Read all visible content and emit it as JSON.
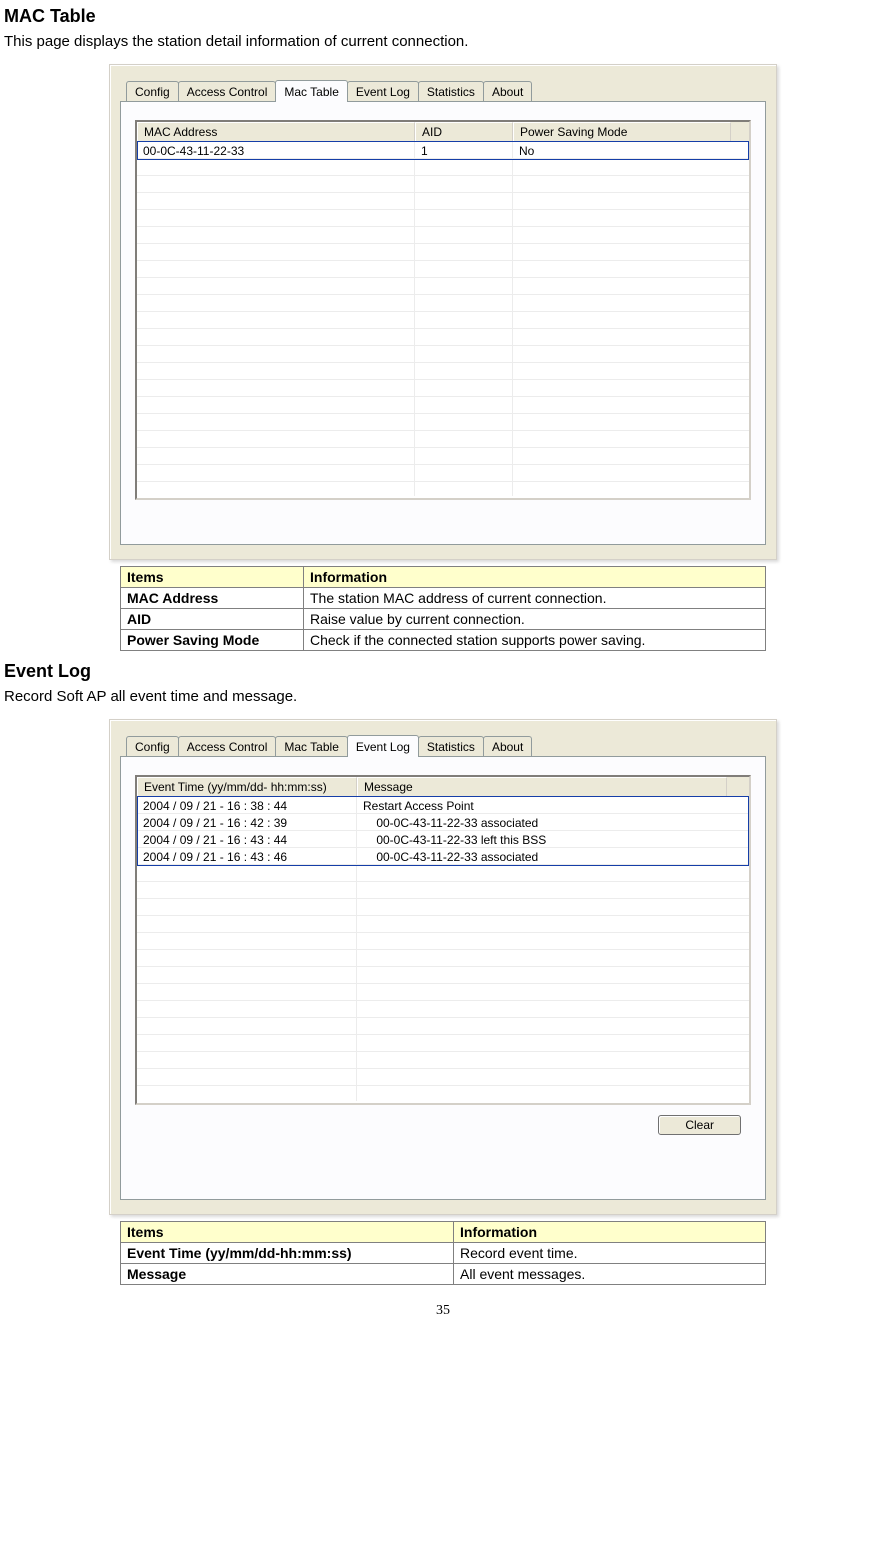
{
  "section1": {
    "title": "MAC Table",
    "desc": "This page displays the station detail information of current connection."
  },
  "tabs": {
    "config": "Config",
    "access_control": "Access Control",
    "mac_table": "Mac Table",
    "event_log": "Event Log",
    "statistics": "Statistics",
    "about": "About"
  },
  "mac_table": {
    "headers": {
      "mac": "MAC Address",
      "aid": "AID",
      "psm": "Power Saving Mode"
    },
    "rows": [
      {
        "mac": "00-0C-43-11-22-33",
        "aid": "1",
        "psm": "No"
      }
    ]
  },
  "mac_desc_table": {
    "h_items": "Items",
    "h_info": "Information",
    "rows": [
      {
        "item": "MAC Address",
        "info": "The station MAC address of current connection."
      },
      {
        "item": "AID",
        "info": "Raise value by current connection."
      },
      {
        "item": "Power Saving Mode",
        "info": "Check if the connected station supports power saving."
      }
    ]
  },
  "section2": {
    "title": "Event Log",
    "desc": "Record Soft AP all event time and message."
  },
  "event_log": {
    "headers": {
      "time": "Event Time (yy/mm/dd- hh:mm:ss)",
      "msg": "Message"
    },
    "rows": [
      {
        "time": "2004 / 09 / 21 - 16 : 38 : 44",
        "msg": "Restart Access Point"
      },
      {
        "time": "2004 / 09 / 21 - 16 : 42 : 39",
        "msg": "    00-0C-43-11-22-33 associated"
      },
      {
        "time": "2004 / 09 / 21 - 16 : 43 : 44",
        "msg": "    00-0C-43-11-22-33 left this BSS"
      },
      {
        "time": "2004 / 09 / 21 - 16 : 43 : 46",
        "msg": "    00-0C-43-11-22-33 associated"
      }
    ],
    "clear_label": "Clear"
  },
  "event_desc_table": {
    "h_items": "Items",
    "h_info": "Information",
    "rows": [
      {
        "item": "Event Time (yy/mm/dd-hh:mm:ss)",
        "info": "Record event time."
      },
      {
        "item": "Message",
        "info": "All event messages."
      }
    ]
  },
  "page_number": "35"
}
